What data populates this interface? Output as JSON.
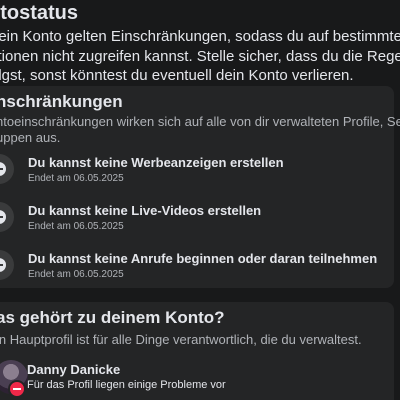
{
  "status": {
    "title": "ntostatus",
    "lines": [
      "dein Konto gelten Einschränkungen, sodass du auf bestimmte",
      "ktionen nicht zugreifen kannst. Stelle sicher, dass du die Regel",
      "olgst, sonst könntest du eventuell dein Konto verlieren."
    ]
  },
  "restrictions": {
    "title": "nschränkungen",
    "desc_lines": [
      "ntoeinschränkungen wirken sich auf alle von dir verwalteten Profile, Seiten und",
      "uppen aus."
    ],
    "items": [
      {
        "title": "Du kannst keine Werbeanzeigen erstellen",
        "date": "Endet am 06.05.2025"
      },
      {
        "title": "Du kannst keine Live-Videos erstellen",
        "date": "Endet am 06.05.2025"
      },
      {
        "title": "Du kannst keine Anrufe beginnen oder daran teilnehmen",
        "date": "Endet am 06.05.2025"
      }
    ]
  },
  "account": {
    "title": "as gehört zu deinem Konto?",
    "desc": "in Hauptprofil ist für alle Dinge verantwortlich, die du verwaltest.",
    "profile": {
      "name": "Danny Danicke",
      "status": "Für das Profil liegen einige Probleme vor"
    }
  },
  "colors": {
    "background": "#18191a",
    "card": "#242526",
    "text_primary": "#e4e6eb",
    "text_secondary": "#b0b3b8",
    "warning_badge": "#f02849"
  },
  "icons": {
    "restriction": "minus-circle-icon",
    "profile_warning": "minus-circle-icon"
  }
}
